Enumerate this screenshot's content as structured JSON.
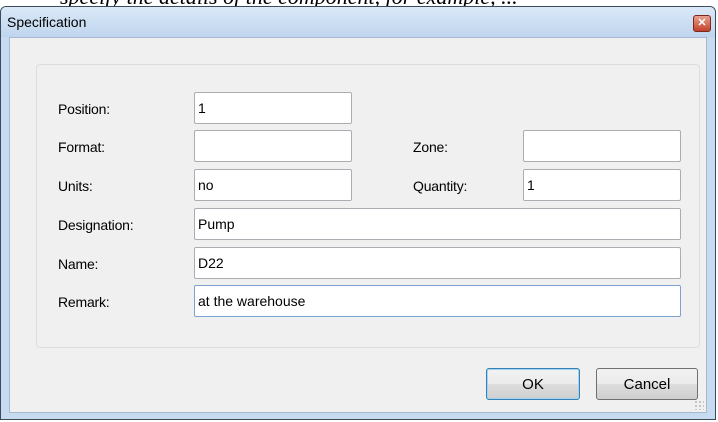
{
  "window": {
    "title": "Specification",
    "close_symbol": "✕"
  },
  "form": {
    "position": {
      "label": "Position:",
      "value": "1"
    },
    "format": {
      "label": "Format:",
      "value": ""
    },
    "zone": {
      "label": "Zone:",
      "value": ""
    },
    "units": {
      "label": "Units:",
      "value": "no"
    },
    "quantity": {
      "label": "Quantity:",
      "value": "1"
    },
    "designation": {
      "label": "Designation:",
      "value": "Pump"
    },
    "name": {
      "label": "Name:",
      "value": "D22"
    },
    "remark": {
      "label": "Remark:",
      "value": "at the warehouse"
    }
  },
  "buttons": {
    "ok": "OK",
    "cancel": "Cancel"
  }
}
